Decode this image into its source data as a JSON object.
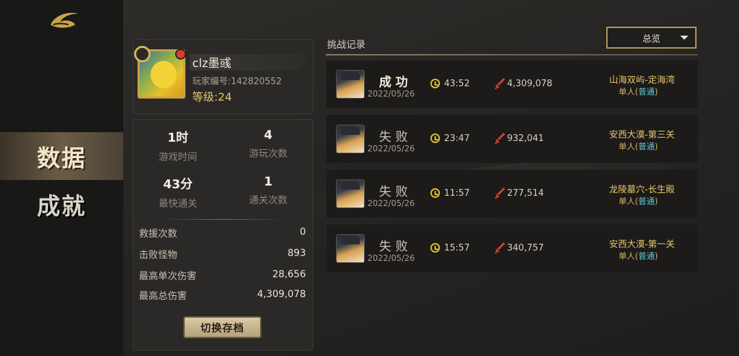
{
  "sidebar": {
    "logo_icon": "stylized-curl-logo",
    "tabs": [
      {
        "label": "数据",
        "active": true
      },
      {
        "label": "成就",
        "active": false
      }
    ]
  },
  "profile": {
    "name": "clz墨彧",
    "player_id": "玩家编号:142820552",
    "level": "等级:24"
  },
  "stats": {
    "play_time": {
      "value": "1时",
      "label": "游戏时间"
    },
    "play_count": {
      "value": "4",
      "label": "游玩次数"
    },
    "fastest_clear": {
      "value": "43分",
      "label": "最快通关"
    },
    "clear_count": {
      "value": "1",
      "label": "通关次数"
    },
    "rows": [
      {
        "label": "救援次数",
        "value": "0"
      },
      {
        "label": "击败怪物",
        "value": "893"
      },
      {
        "label": "最高单次伤害",
        "value": "28,656"
      },
      {
        "label": "最高总伤害",
        "value": "4,309,078"
      }
    ],
    "switch_button": "切换存档"
  },
  "records": {
    "title": "挑战记录",
    "filter": "总览",
    "items": [
      {
        "result": "成功",
        "win": true,
        "date": "2022/05/26",
        "time": "43:52",
        "damage": "4,309,078",
        "stage": "山海双屿-定海湾",
        "mode": "单人",
        "difficulty": "普通"
      },
      {
        "result": "失败",
        "win": false,
        "date": "2022/05/26",
        "time": "23:47",
        "damage": "932,041",
        "stage": "安西大漠-第三关",
        "mode": "单人",
        "difficulty": "普通"
      },
      {
        "result": "失败",
        "win": false,
        "date": "2022/05/26",
        "time": "11:57",
        "damage": "277,514",
        "stage": "龙陵墓穴-长生殿",
        "mode": "单人",
        "difficulty": "普通"
      },
      {
        "result": "失败",
        "win": false,
        "date": "2022/05/26",
        "time": "15:57",
        "damage": "340,757",
        "stage": "安西大漠-第一关",
        "mode": "单人",
        "difficulty": "普通"
      }
    ]
  },
  "colors": {
    "gold": "#e7c66a",
    "difficulty": "#5fc6d8",
    "clock": "#e1c12a",
    "sword": "#d9452f"
  }
}
